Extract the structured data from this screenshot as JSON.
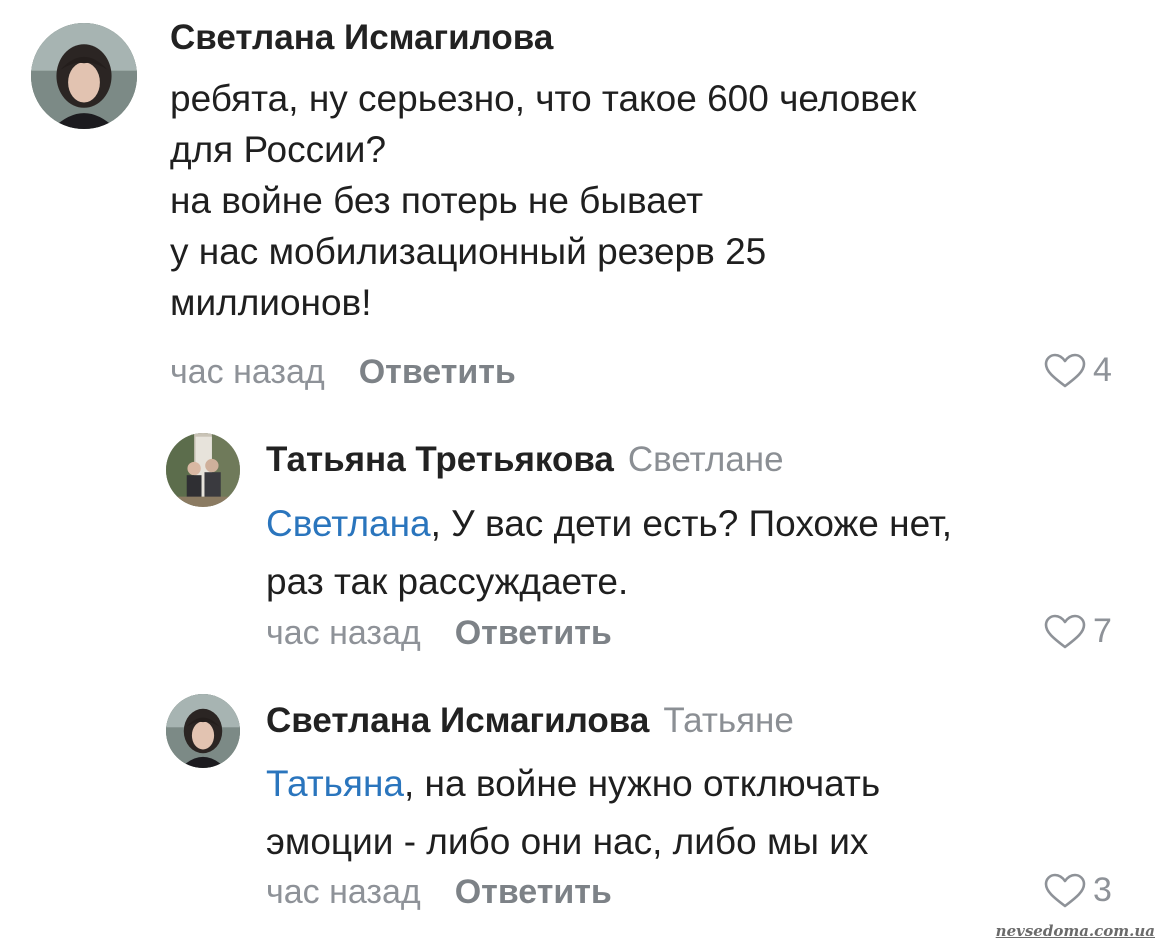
{
  "comments": [
    {
      "author": "Светлана Исмагилова",
      "reply_to": "",
      "lines": [
        "ребята, ну серьезно, что такое 600 человек",
        "для России?",
        "на войне без потерь не бывает",
        "у нас мобилизационный резерв 25",
        "миллионов!"
      ],
      "time": "час назад",
      "reply_label": "Ответить",
      "likes": "4"
    },
    {
      "author": "Татьяна Третьякова",
      "reply_to": "Светлане",
      "mention": "Светлана",
      "lines": [
        ", У вас дети есть? Похоже нет,",
        "раз так рассуждаете."
      ],
      "time": "час назад",
      "reply_label": "Ответить",
      "likes": "7"
    },
    {
      "author": "Светлана Исмагилова",
      "reply_to": "Татьяне",
      "mention": "Татьяна",
      "lines": [
        ", на войне нужно отключать",
        "эмоции - либо они нас, либо мы их"
      ],
      "time": "час назад",
      "reply_label": "Ответить",
      "likes": "3"
    }
  ],
  "watermark": "nevsedoma.com.ua",
  "colors": {
    "text": "#1f1f1f",
    "muted": "#8e9298",
    "mention": "#2a75bd"
  },
  "icons": {
    "like": "heart-outline-icon"
  }
}
